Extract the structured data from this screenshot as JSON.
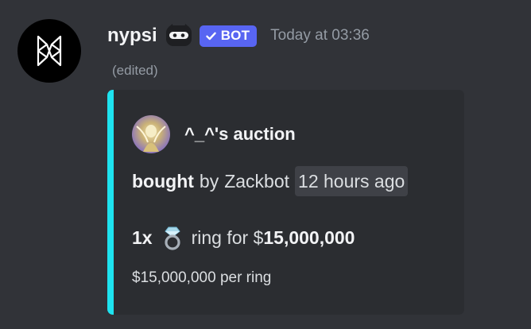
{
  "message": {
    "username": "nypsi",
    "bot_tag": "BOT",
    "timestamp": "Today at 03:36",
    "edited_label": "(edited)"
  },
  "embed": {
    "accent_color": "#1ee3f0",
    "author": "^_^'s auction",
    "action": "bought",
    "by_label": "by",
    "buyer": "Zackbot",
    "time_ago": "12 hours ago",
    "quantity": "1x",
    "item_emoji": "ring-icon",
    "item_for_prefix": "ring for $",
    "price": "15,000,000",
    "per_item": "$15,000,000 per ring"
  },
  "colors": {
    "background": "#313338",
    "embed_background": "#2b2d31",
    "bot_tag": "#5865f2",
    "muted_text": "#949ba4"
  }
}
